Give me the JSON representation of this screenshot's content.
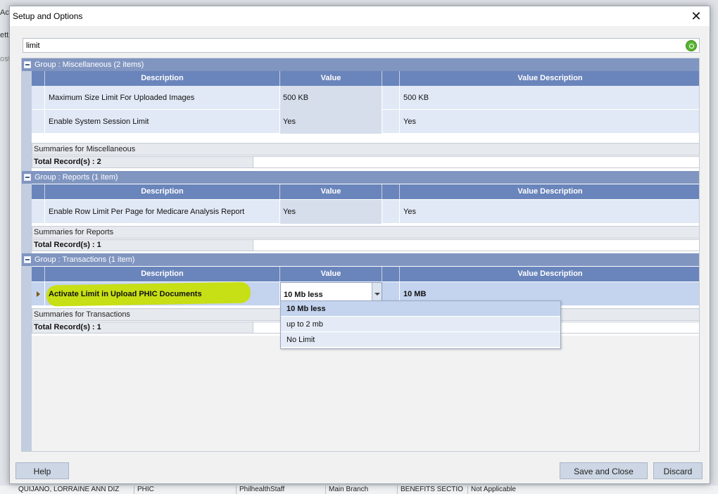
{
  "background": {
    "fragments": [
      "Act",
      "etti",
      "ost"
    ],
    "footer": [
      "QUIJANO, LORRAINE ANN DIZ",
      "PHIC",
      "PhilhealthStaff",
      "Main Branch",
      "BENEFITS SECTIO",
      "Not Applicable"
    ]
  },
  "dialog": {
    "title": "Setup and Options",
    "close_icon": "close-icon"
  },
  "search": {
    "value": "limit",
    "go_icon": "search-go-icon"
  },
  "columns": {
    "description": "Description",
    "value": "Value",
    "value_description": "Value Description"
  },
  "groups": [
    {
      "header": "Group : Miscellaneous (2 items)",
      "rows": [
        {
          "description": "Maximum Size Limit For Uploaded Images",
          "value": "500 KB",
          "value_description": "500 KB"
        },
        {
          "description": "Enable System Session Limit",
          "value": "Yes",
          "value_description": "Yes"
        }
      ],
      "summary": "Summaries for Miscellaneous",
      "total": "Total Record(s) : 2"
    },
    {
      "header": "Group : Reports (1 item)",
      "rows": [
        {
          "description": "Enable Row Limit Per Page for Medicare Analysis Report",
          "value": "Yes",
          "value_description": "Yes"
        }
      ],
      "summary": "Summaries for Reports",
      "total": "Total Record(s) : 1"
    },
    {
      "header": "Group : Transactions (1 item)",
      "rows": [
        {
          "description": "Activate Limit in Upload PHIC Documents",
          "value": "10 Mb less",
          "value_description": "10 MB"
        }
      ],
      "summary": "Summaries for Transactions",
      "total": "Total Record(s) : 1"
    }
  ],
  "dropdown": {
    "options": [
      "10 Mb less",
      "up to 2 mb",
      "No Limit"
    ],
    "selected": "10 Mb less"
  },
  "buttons": {
    "help": "Help",
    "save_close": "Save and Close",
    "discard": "Discard"
  },
  "colors": {
    "group_header": "#8095c0",
    "column_header": "#6a85bb",
    "highlight": "#c7df15"
  }
}
